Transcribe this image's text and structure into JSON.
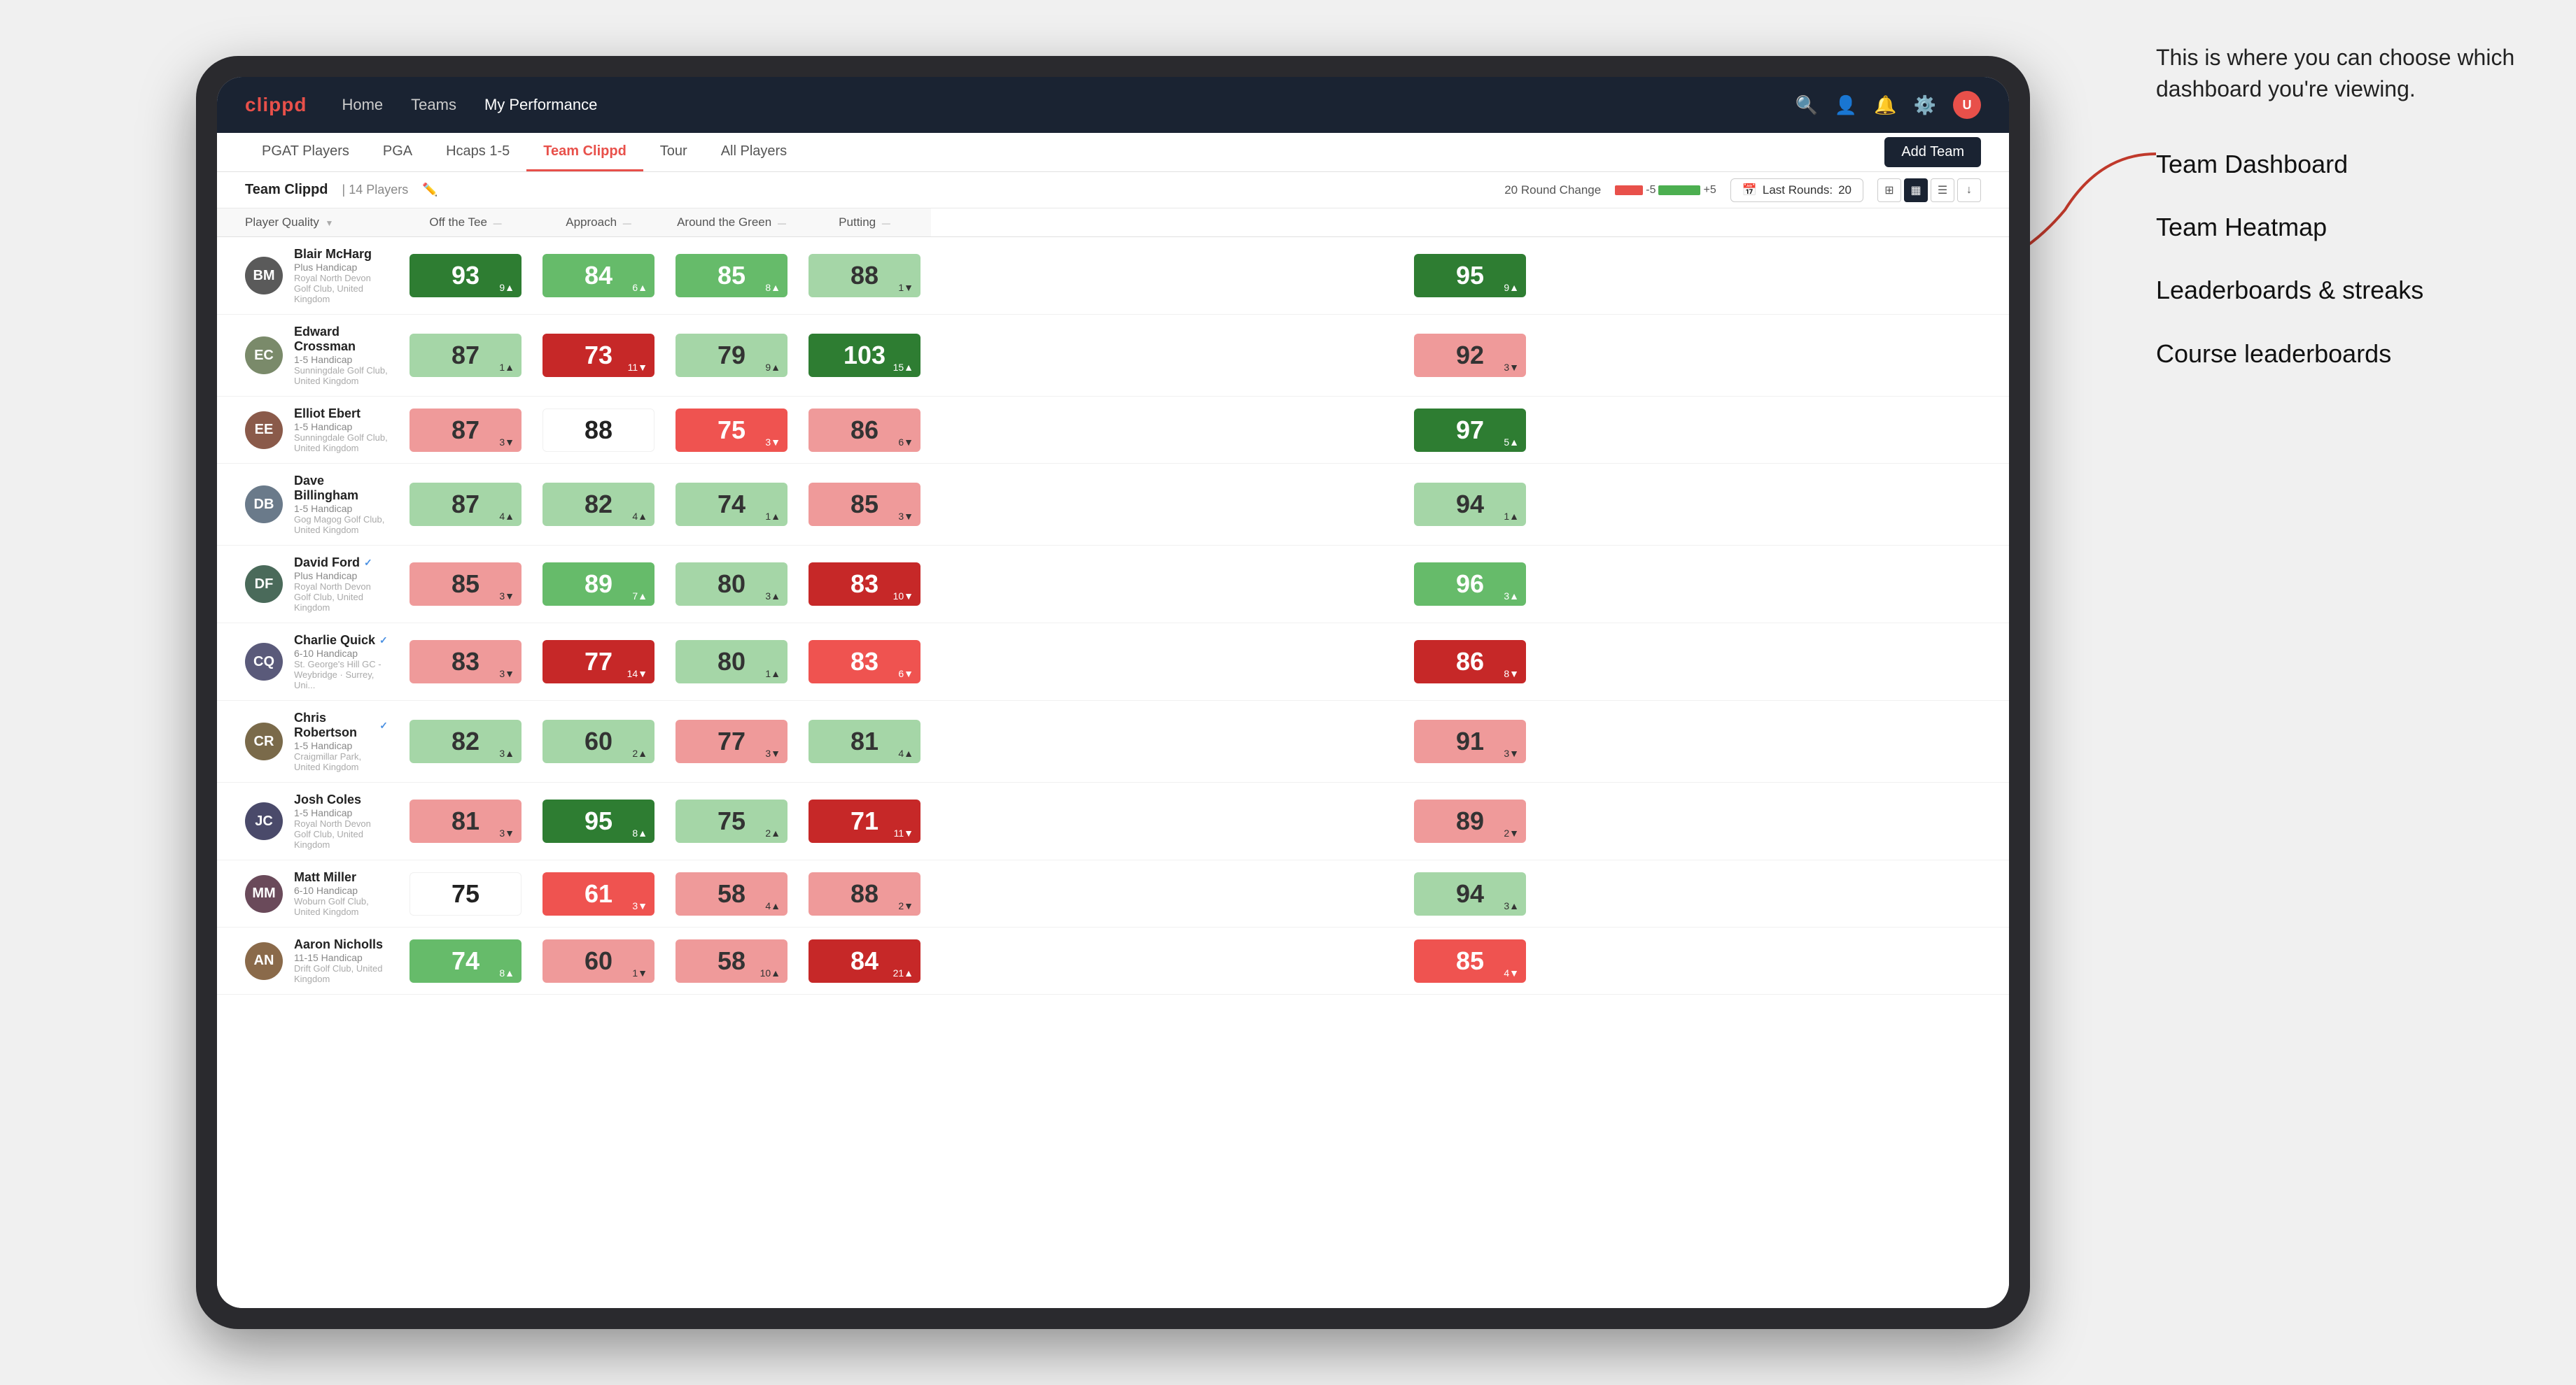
{
  "annotation": {
    "intro": "This is where you can choose which dashboard you're viewing.",
    "items": [
      "Team Dashboard",
      "Team Heatmap",
      "Leaderboards & streaks",
      "Course leaderboards"
    ]
  },
  "navbar": {
    "logo": "clippd",
    "nav_items": [
      "Home",
      "Teams",
      "My Performance"
    ],
    "active_nav": "My Performance"
  },
  "subnav": {
    "tabs": [
      "PGAT Players",
      "PGA",
      "Hcaps 1-5",
      "Team Clippd",
      "Tour",
      "All Players"
    ],
    "active_tab": "Team Clippd",
    "add_team_label": "Add Team"
  },
  "team_header": {
    "team_name": "Team Clippd",
    "separator": "|",
    "player_count": "14 Players",
    "round_change_label": "20 Round Change",
    "bar_neg_label": "-5",
    "bar_pos_label": "+5",
    "last_rounds_label": "Last Rounds:",
    "last_rounds_value": "20"
  },
  "table": {
    "columns": {
      "player": "Player Quality",
      "off_tee": "Off the Tee",
      "approach": "Approach",
      "around_green": "Around the Green",
      "putting": "Putting"
    },
    "rows": [
      {
        "name": "Blair McHarg",
        "handicap": "Plus Handicap",
        "club": "Royal North Devon Golf Club, United Kingdom",
        "avatar_color": "#5a5a5a",
        "avatar_initials": "BM",
        "verified": false,
        "scores": [
          {
            "value": "93",
            "change": "9",
            "dir": "up",
            "color": "green-dark"
          },
          {
            "value": "84",
            "change": "6",
            "dir": "up",
            "color": "green-med"
          },
          {
            "value": "85",
            "change": "8",
            "dir": "up",
            "color": "green-med"
          },
          {
            "value": "88",
            "change": "1",
            "dir": "down",
            "color": "green-light"
          },
          {
            "value": "95",
            "change": "9",
            "dir": "up",
            "color": "green-dark"
          }
        ]
      },
      {
        "name": "Edward Crossman",
        "handicap": "1-5 Handicap",
        "club": "Sunningdale Golf Club, United Kingdom",
        "avatar_color": "#7a8a6a",
        "avatar_initials": "EC",
        "verified": false,
        "scores": [
          {
            "value": "87",
            "change": "1",
            "dir": "up",
            "color": "green-light"
          },
          {
            "value": "73",
            "change": "11",
            "dir": "down",
            "color": "red-dark"
          },
          {
            "value": "79",
            "change": "9",
            "dir": "up",
            "color": "green-light"
          },
          {
            "value": "103",
            "change": "15",
            "dir": "up",
            "color": "green-dark"
          },
          {
            "value": "92",
            "change": "3",
            "dir": "down",
            "color": "red-light"
          }
        ]
      },
      {
        "name": "Elliot Ebert",
        "handicap": "1-5 Handicap",
        "club": "Sunningdale Golf Club, United Kingdom",
        "avatar_color": "#8a5a4a",
        "avatar_initials": "EE",
        "verified": false,
        "scores": [
          {
            "value": "87",
            "change": "3",
            "dir": "down",
            "color": "red-light"
          },
          {
            "value": "88",
            "change": "",
            "dir": "",
            "color": "white"
          },
          {
            "value": "75",
            "change": "3",
            "dir": "down",
            "color": "red-med"
          },
          {
            "value": "86",
            "change": "6",
            "dir": "down",
            "color": "red-light"
          },
          {
            "value": "97",
            "change": "5",
            "dir": "up",
            "color": "green-dark"
          }
        ]
      },
      {
        "name": "Dave Billingham",
        "handicap": "1-5 Handicap",
        "club": "Gog Magog Golf Club, United Kingdom",
        "avatar_color": "#6a7a8a",
        "avatar_initials": "DB",
        "verified": false,
        "scores": [
          {
            "value": "87",
            "change": "4",
            "dir": "up",
            "color": "green-light"
          },
          {
            "value": "82",
            "change": "4",
            "dir": "up",
            "color": "green-light"
          },
          {
            "value": "74",
            "change": "1",
            "dir": "up",
            "color": "green-light"
          },
          {
            "value": "85",
            "change": "3",
            "dir": "down",
            "color": "red-light"
          },
          {
            "value": "94",
            "change": "1",
            "dir": "up",
            "color": "green-light"
          }
        ]
      },
      {
        "name": "David Ford",
        "handicap": "Plus Handicap",
        "club": "Royal North Devon Golf Club, United Kingdom",
        "avatar_color": "#4a6a5a",
        "avatar_initials": "DF",
        "verified": true,
        "scores": [
          {
            "value": "85",
            "change": "3",
            "dir": "down",
            "color": "red-light"
          },
          {
            "value": "89",
            "change": "7",
            "dir": "up",
            "color": "green-med"
          },
          {
            "value": "80",
            "change": "3",
            "dir": "up",
            "color": "green-light"
          },
          {
            "value": "83",
            "change": "10",
            "dir": "down",
            "color": "red-dark"
          },
          {
            "value": "96",
            "change": "3",
            "dir": "up",
            "color": "green-med"
          }
        ]
      },
      {
        "name": "Charlie Quick",
        "handicap": "6-10 Handicap",
        "club": "St. George's Hill GC - Weybridge · Surrey, Uni...",
        "avatar_color": "#5a5a7a",
        "avatar_initials": "CQ",
        "verified": true,
        "scores": [
          {
            "value": "83",
            "change": "3",
            "dir": "down",
            "color": "red-light"
          },
          {
            "value": "77",
            "change": "14",
            "dir": "down",
            "color": "red-dark"
          },
          {
            "value": "80",
            "change": "1",
            "dir": "up",
            "color": "green-light"
          },
          {
            "value": "83",
            "change": "6",
            "dir": "down",
            "color": "red-med"
          },
          {
            "value": "86",
            "change": "8",
            "dir": "down",
            "color": "red-dark"
          }
        ]
      },
      {
        "name": "Chris Robertson",
        "handicap": "1-5 Handicap",
        "club": "Craigmillar Park, United Kingdom",
        "avatar_color": "#7a6a4a",
        "avatar_initials": "CR",
        "verified": true,
        "scores": [
          {
            "value": "82",
            "change": "3",
            "dir": "up",
            "color": "green-light"
          },
          {
            "value": "60",
            "change": "2",
            "dir": "up",
            "color": "green-light"
          },
          {
            "value": "77",
            "change": "3",
            "dir": "down",
            "color": "red-light"
          },
          {
            "value": "81",
            "change": "4",
            "dir": "up",
            "color": "green-light"
          },
          {
            "value": "91",
            "change": "3",
            "dir": "down",
            "color": "red-light"
          }
        ]
      },
      {
        "name": "Josh Coles",
        "handicap": "1-5 Handicap",
        "club": "Royal North Devon Golf Club, United Kingdom",
        "avatar_color": "#4a4a6a",
        "avatar_initials": "JC",
        "verified": false,
        "scores": [
          {
            "value": "81",
            "change": "3",
            "dir": "down",
            "color": "red-light"
          },
          {
            "value": "95",
            "change": "8",
            "dir": "up",
            "color": "green-dark"
          },
          {
            "value": "75",
            "change": "2",
            "dir": "up",
            "color": "green-light"
          },
          {
            "value": "71",
            "change": "11",
            "dir": "down",
            "color": "red-dark"
          },
          {
            "value": "89",
            "change": "2",
            "dir": "down",
            "color": "red-light"
          }
        ]
      },
      {
        "name": "Matt Miller",
        "handicap": "6-10 Handicap",
        "club": "Woburn Golf Club, United Kingdom",
        "avatar_color": "#6a4a5a",
        "avatar_initials": "MM",
        "verified": false,
        "scores": [
          {
            "value": "75",
            "change": "",
            "dir": "",
            "color": "white"
          },
          {
            "value": "61",
            "change": "3",
            "dir": "down",
            "color": "red-med"
          },
          {
            "value": "58",
            "change": "4",
            "dir": "up",
            "color": "red-light"
          },
          {
            "value": "88",
            "change": "2",
            "dir": "down",
            "color": "red-light"
          },
          {
            "value": "94",
            "change": "3",
            "dir": "up",
            "color": "green-light"
          }
        ]
      },
      {
        "name": "Aaron Nicholls",
        "handicap": "11-15 Handicap",
        "club": "Drift Golf Club, United Kingdom",
        "avatar_color": "#8a6a4a",
        "avatar_initials": "AN",
        "verified": false,
        "scores": [
          {
            "value": "74",
            "change": "8",
            "dir": "up",
            "color": "green-med"
          },
          {
            "value": "60",
            "change": "1",
            "dir": "down",
            "color": "red-light"
          },
          {
            "value": "58",
            "change": "10",
            "dir": "up",
            "color": "red-light"
          },
          {
            "value": "84",
            "change": "21",
            "dir": "up",
            "color": "red-dark"
          },
          {
            "value": "85",
            "change": "4",
            "dir": "down",
            "color": "red-med"
          }
        ]
      }
    ]
  }
}
